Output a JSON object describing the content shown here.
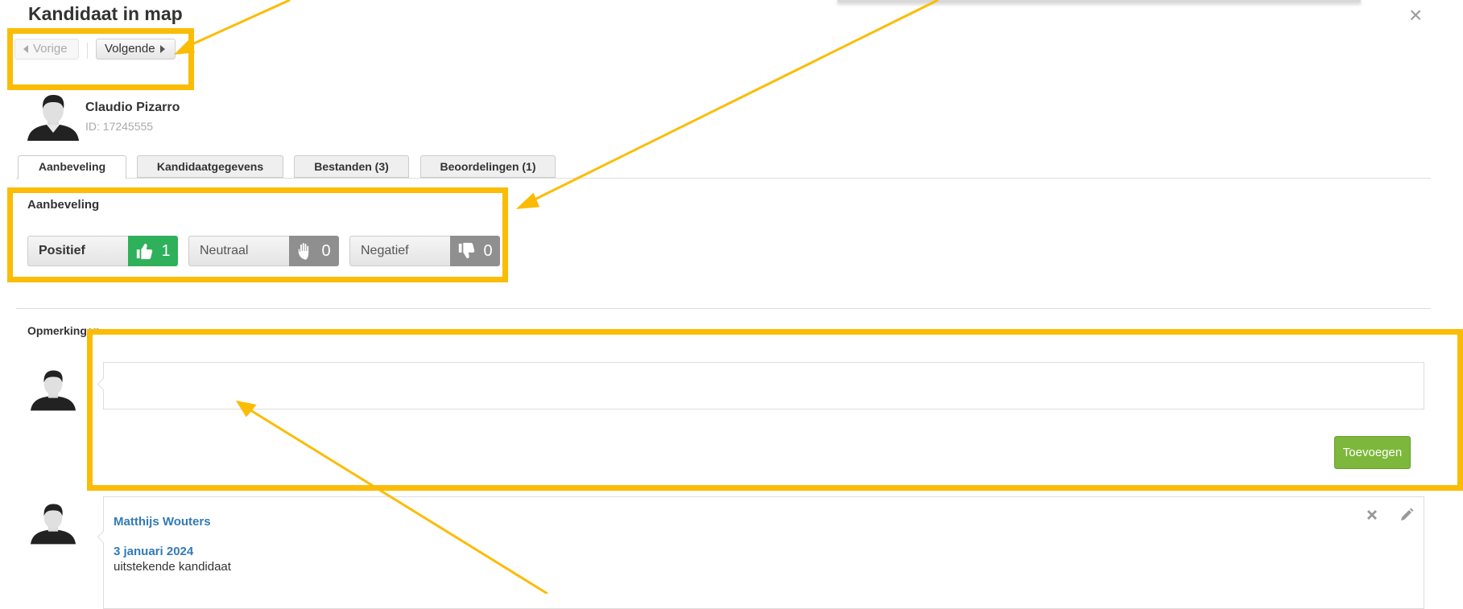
{
  "dialog": {
    "title": "Kandidaat in map",
    "close_label": "×"
  },
  "nav": {
    "prev_label": "Vorige",
    "next_label": "Volgende"
  },
  "candidate": {
    "name": "Claudio Pizarro",
    "id_text": "ID: 17245555"
  },
  "tabs": [
    {
      "label": "Aanbeveling",
      "active": true
    },
    {
      "label": "Kandidaatgegevens"
    },
    {
      "label": "Bestanden (3)"
    },
    {
      "label": "Beoordelingen (1)"
    }
  ],
  "recommendation": {
    "heading": "Aanbeveling",
    "options": [
      {
        "label": "Positief",
        "count": "1",
        "icon": "thumbs-up-icon",
        "color": "#2fb05a"
      },
      {
        "label": "Neutraal",
        "count": "0",
        "icon": "hand-icon",
        "color": "#8f8f8f"
      },
      {
        "label": "Negatief",
        "count": "0",
        "icon": "thumbs-down-icon",
        "color": "#8f8f8f"
      }
    ]
  },
  "comments": {
    "heading": "Opmerkingen",
    "input_value": "",
    "add_label": "Toevoegen",
    "items": [
      {
        "author": "Matthijs Wouters",
        "date": "3 januari 2024",
        "text": "uitstekende kandidaat"
      }
    ]
  },
  "colors": {
    "highlight": "#fbbc05",
    "link": "#337ab7",
    "add_button": "#7db73b"
  }
}
